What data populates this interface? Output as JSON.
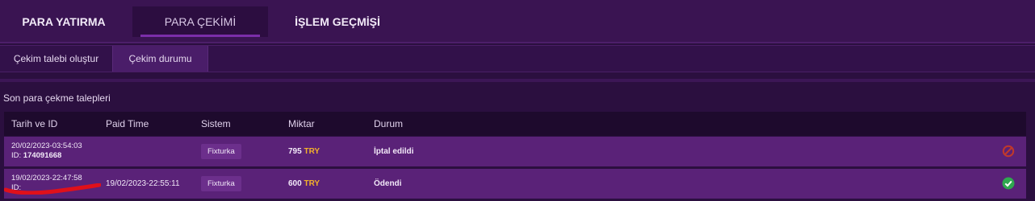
{
  "main_tabs": [
    {
      "label": "PARA YATIRMA"
    },
    {
      "label": "PARA ÇEKİMİ"
    },
    {
      "label": "İŞLEM GEÇMİŞİ"
    }
  ],
  "sub_tabs": [
    {
      "label": "Çekim talebi oluştur"
    },
    {
      "label": "Çekim durumu"
    }
  ],
  "section_title": "Son para çekme talepleri",
  "columns": [
    "Tarih ve ID",
    "Paid Time",
    "Sistem",
    "Miktar",
    "Durum"
  ],
  "rows": [
    {
      "date": "20/02/2023-03:54:03",
      "id_label": "ID:",
      "id": "174091668",
      "paid_time": "",
      "system": "Fixturka",
      "amount": "795",
      "currency": "TRY",
      "status": "İptal edildi",
      "status_icon": "cancel-icon"
    },
    {
      "date": "19/02/2023-22:47:58",
      "id_label": "ID:",
      "id": "",
      "paid_time": "19/02/2023-22:55:11",
      "system": "Fixturka",
      "amount": "600",
      "currency": "TRY",
      "status": "Ödendi",
      "status_icon": "check-icon"
    }
  ],
  "colors": {
    "background": "#2b0f3f",
    "accent": "#7b2ea8",
    "currency": "#f3b12a",
    "cancel": "#c0392b",
    "success": "#2fa84f"
  }
}
